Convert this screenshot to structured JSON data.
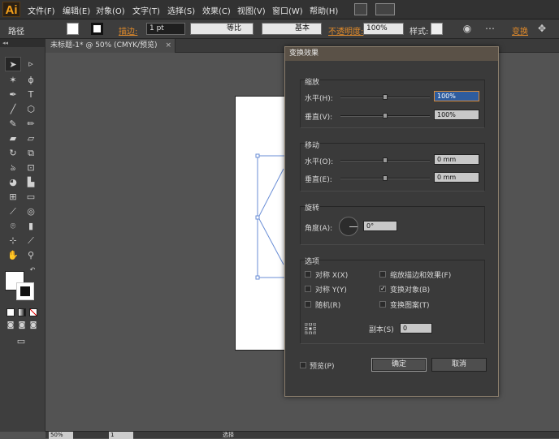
{
  "app": {
    "logo": "Ai"
  },
  "menubar": {
    "items": [
      "文件(F)",
      "编辑(E)",
      "对象(O)",
      "文字(T)",
      "选择(S)",
      "效果(C)",
      "视图(V)",
      "窗口(W)",
      "帮助(H)"
    ]
  },
  "controlbar": {
    "object_type": "路径",
    "stroke_label": "描边:",
    "stroke_weight": "1 pt",
    "profile_label": "等比",
    "brush_label": "基本",
    "opacity_label": "不透明度:",
    "opacity_value": "100%",
    "style_label": "样式:",
    "transform_label": "变换"
  },
  "tab": {
    "title": "未标题-1* @ 50% (CMYK/预览)",
    "close": "×"
  },
  "status": {
    "zoom": "50%",
    "page": "1",
    "tool": "选择"
  },
  "dialog": {
    "title": "变换效果",
    "scale": {
      "label": "缩放",
      "horizontal_label": "水平(H):",
      "horizontal_value": "100%",
      "horizontal_level": 0.5,
      "vertical_label": "垂直(V):",
      "vertical_value": "100%",
      "vertical_level": 0.5
    },
    "move": {
      "label": "移动",
      "horizontal_label": "水平(O):",
      "horizontal_value": "0 mm",
      "horizontal_level": 0.5,
      "vertical_label": "垂直(E):",
      "vertical_value": "0 mm",
      "vertical_level": 0.5
    },
    "rotate": {
      "label": "旋转",
      "angle_label": "角度(A):",
      "angle_value": "0°"
    },
    "options": {
      "label": "选项",
      "reflect_x": {
        "label": "对称 X(X)",
        "checked": false
      },
      "reflect_y": {
        "label": "对称 Y(Y)",
        "checked": false
      },
      "random": {
        "label": "随机(R)",
        "checked": false
      },
      "scale_strokes": {
        "label": "缩放描边和效果(F)",
        "checked": false
      },
      "transform_objects": {
        "label": "变换对象(B)",
        "checked": true
      },
      "transform_patterns": {
        "label": "变换图案(T)",
        "checked": false
      },
      "copies_label": "副本(S)",
      "copies_value": "0"
    },
    "preview": {
      "label": "预览(P)",
      "checked": false
    },
    "ok_label": "确定",
    "cancel_label": "取消"
  },
  "colors": {
    "accent": "#f7a21b",
    "selection": "#2e5c9e",
    "path": "#6a8ed6"
  }
}
